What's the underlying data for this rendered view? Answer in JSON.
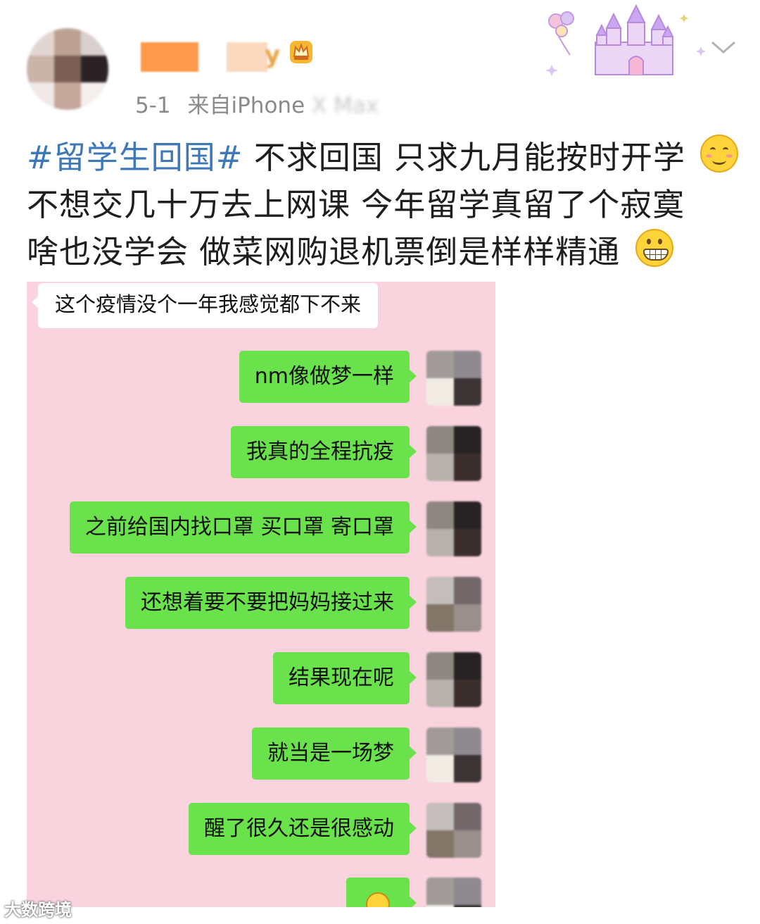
{
  "post": {
    "username_fragment": "y",
    "timestamp": "5-1",
    "source_prefix": "来自",
    "device": "iPhone",
    "device_obscured": " X Max",
    "text": {
      "hashtag": "#留学生回国#",
      "line1_rest": " 不求回国 只求九月能按时开学",
      "line2": "不想交几十万去上网课 今年留学真留了个寂寞",
      "line3": "啥也没学会 做菜网购退机票倒是样样精通"
    }
  },
  "chat": {
    "received": "这个疫情没个一年我感觉都下不来",
    "sent": [
      "nm像做梦一样",
      "我真的全程抗疫",
      "之前给国内找口罩 买口罩 寄口罩",
      "还想着要不要把妈妈接过来",
      "结果现在呢",
      "就当是一场梦",
      "醒了很久还是很感动"
    ]
  },
  "watermark": "大数跨境",
  "colors": {
    "hashtag": "#3d78b8",
    "chat_background": "#f9d3de",
    "sent_bubble": "#6ae24c",
    "received_bubble": "#ffffff"
  },
  "icons": [
    "crown-badge-icon",
    "castle-decoration-icon",
    "chevron-down-icon",
    "smiling-emoji-icon",
    "grinning-emoji-icon"
  ]
}
